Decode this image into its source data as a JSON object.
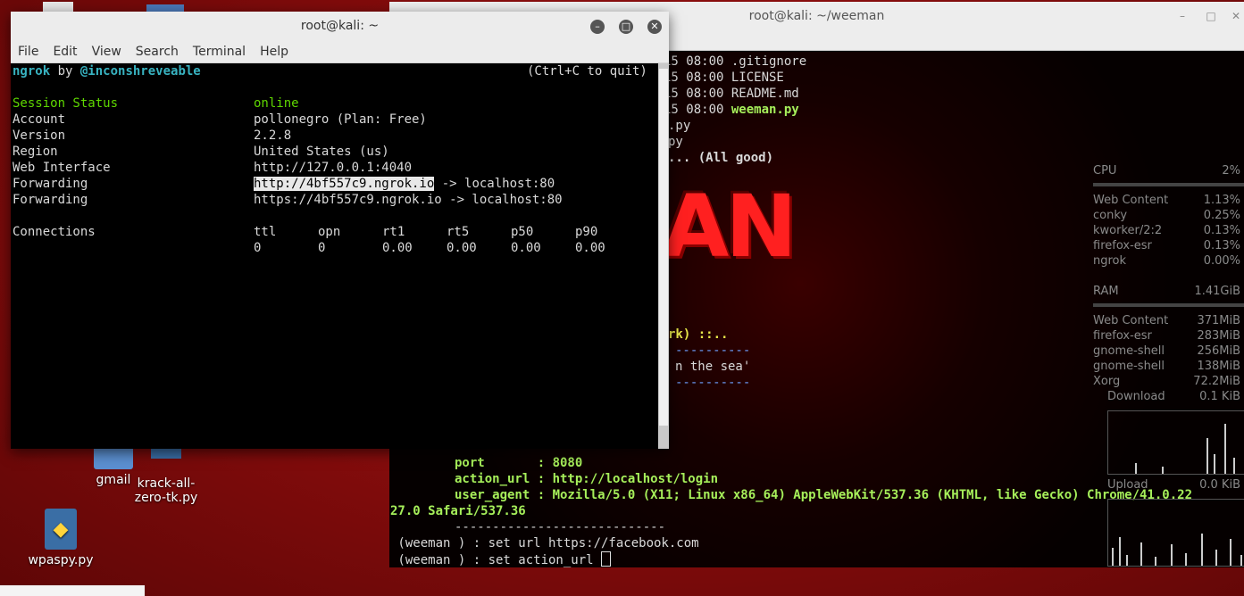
{
  "desktop": {
    "icons": [
      {
        "label": "gmail"
      },
      {
        "label": "krack-all-\nzero-tk.py"
      },
      {
        "label": "wpaspy.py"
      }
    ]
  },
  "back_window": {
    "title": "root@kali: ~/weeman",
    "lines": [
      "15 08:00 .gitignore",
      "15 08:00 LICENSE",
      "15 08:00 README.md",
      "15 08:00 ",
      "weeman.py",
      ".py",
      "py",
      "... (All good)",
      "rk) ::..",
      "----------",
      "n the sea'",
      "----------",
      "port       : ",
      "8080",
      "action_url : ",
      "http://localhost/login",
      "user_agent : ",
      "Mozilla/5.0 (X11; Linux x86_64) AppleWebKit/537.36 (KHTML, like Gecko) Chrome/41.0.22",
      "27.0 Safari/537.36",
      "----------------------------",
      " (weeman ) : set url https://facebook.com",
      " (weeman ) : set action_url ",
      "AN"
    ],
    "conky": {
      "cpu_label": "CPU",
      "cpu_value": "2%",
      "cpu_procs": [
        {
          "name": "Web Content",
          "value": "1.13%"
        },
        {
          "name": "conky",
          "value": "0.25%"
        },
        {
          "name": "kworker/2:2",
          "value": "0.13%"
        },
        {
          "name": "firefox-esr",
          "value": "0.13%"
        },
        {
          "name": "ngrok",
          "value": "0.00%"
        }
      ],
      "ram_label": "RAM",
      "ram_value": "1.41GiB",
      "ram_procs": [
        {
          "name": "Web Content",
          "value": "371MiB"
        },
        {
          "name": "firefox-esr",
          "value": "283MiB"
        },
        {
          "name": "gnome-shell",
          "value": "256MiB"
        },
        {
          "name": "gnome-shell",
          "value": "138MiB"
        },
        {
          "name": "Xorg",
          "value": "72.2MiB"
        }
      ],
      "download_label": "Download",
      "download_value": "0.1 KiB",
      "upload_label": "Upload",
      "upload_value": "0.0 KiB"
    }
  },
  "front_window": {
    "title": "root@kali: ~",
    "menu": [
      "File",
      "Edit",
      "View",
      "Search",
      "Terminal",
      "Help"
    ],
    "ngrok_header": {
      "left_1": "ngrok",
      "left_2": " by ",
      "left_3": "@inconshreveable",
      "right": "(Ctrl+C to quit)"
    },
    "rows": [
      {
        "key": "Session Status",
        "value": "online"
      },
      {
        "key": "Account",
        "value": "pollonegro (Plan: Free)"
      },
      {
        "key": "Version",
        "value": "2.2.8"
      },
      {
        "key": "Region",
        "value": "United States (us)"
      },
      {
        "key": "Web Interface",
        "value": "http://127.0.0.1:4040"
      },
      {
        "key": "Forwarding",
        "value_hl": "http://4bf557c9.ngrok.io",
        "value_rest": " -> localhost:80"
      },
      {
        "key": "Forwarding",
        "value": "https://4bf557c9.ngrok.io -> localhost:80"
      }
    ],
    "connections": {
      "key": "Connections",
      "headers": [
        "ttl",
        "opn",
        "rt1",
        "rt5",
        "p50",
        "p90"
      ],
      "values": [
        "0",
        "0",
        "0.00",
        "0.00",
        "0.00",
        "0.00"
      ]
    }
  }
}
